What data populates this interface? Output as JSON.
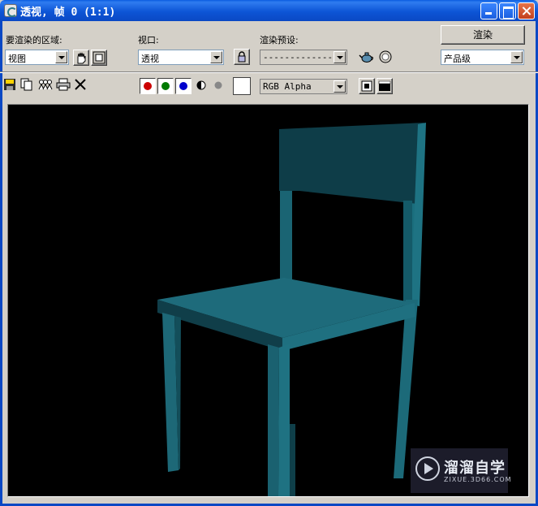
{
  "window": {
    "title": "透视, 帧 0 (1:1)",
    "title_bar_color": "#0a5be0"
  },
  "controls": {
    "area_label": "要渲染的区域:",
    "area_value": "视图",
    "viewport_label": "视口:",
    "viewport_value": "透视",
    "preset_label": "渲染预设:",
    "preset_value": "---------------",
    "render_button": "渲染",
    "quality_value": "产品级"
  },
  "toolbar": {
    "channel_colors": {
      "red": "#cc0000",
      "green": "#007a00",
      "blue": "#0000cc",
      "mono": "#888888"
    },
    "display_channel": "RGB Alpha",
    "swatch_color": "#ffffff"
  },
  "viewport": {
    "background": "#000000",
    "object": "chair",
    "object_color": "#1f6a78"
  },
  "watermark": {
    "name": "溜溜自学",
    "url": "ZIXUE.3D66.COM"
  }
}
